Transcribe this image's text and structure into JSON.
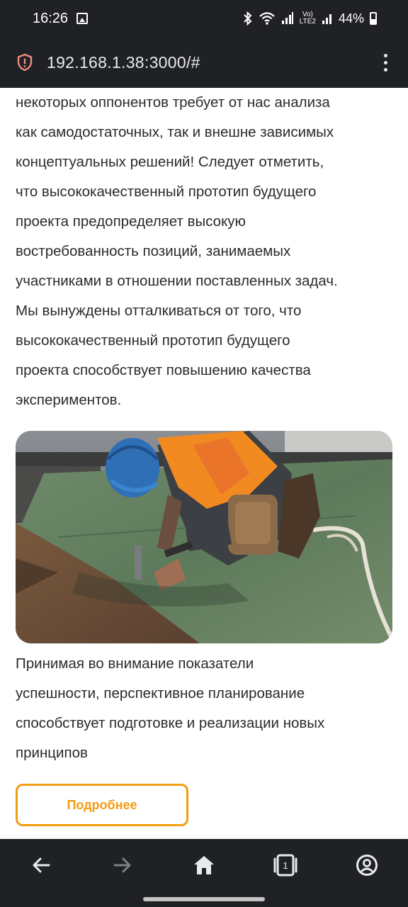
{
  "status_bar": {
    "time": "16:26",
    "battery": "44%",
    "network": "LTE2",
    "icons": [
      "image-icon",
      "bluetooth-icon",
      "wifi-icon",
      "signal-icon",
      "volte-icon",
      "battery-icon"
    ]
  },
  "browser": {
    "url": "192.168.1.38:3000/#",
    "security_icon": "shield-alert-icon",
    "menu_icon": "more-vert-icon"
  },
  "article": {
    "paragraph_top_lines": [
      "некоторых оппонентов требует от нас анализа",
      "как самодостаточных, так и внешне зависимых",
      "концептуальных решений! Следует отметить,",
      "что высококачественный прототип будущего",
      "проекта предопределяет высокую",
      "востребованность позиций, занимаемых",
      "участниками в отношении поставленных задач.",
      "Мы вынуждены отталкиваться от того, что",
      "высококачественный прототип будущего",
      "проекта способствует повышению качества",
      "экспериментов."
    ],
    "paragraph_bottom_lines": [
      "Принимая во внимание показатели",
      "успешности, перспективное планирование",
      "способствует подготовке и реализации новых",
      "принципов"
    ],
    "more_button": "Подробнее"
  },
  "colors": {
    "accent": "#f29d12",
    "chrome": "#202124",
    "text": "#2b2b2b"
  },
  "nav_bar": {
    "items": [
      "back-icon",
      "forward-icon",
      "home-icon",
      "tabs-icon",
      "account-icon"
    ],
    "tab_count": "1"
  }
}
